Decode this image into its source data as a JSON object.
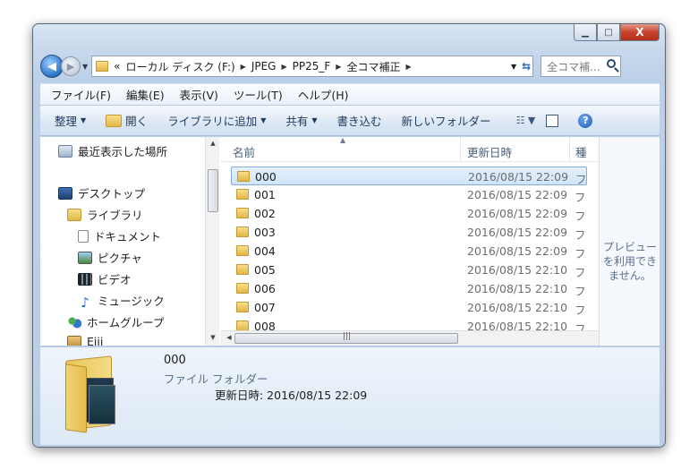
{
  "window": {
    "caption": {
      "minimize": "▁",
      "maximize": "□",
      "close": "X"
    }
  },
  "address": {
    "overflow": "«",
    "crumbs": [
      "ローカル ディスク (F:)",
      "JPEG",
      "PP25_F",
      "全コマ補正"
    ],
    "search_placeholder": "全コマ補..."
  },
  "menu": [
    "ファイル(F)",
    "編集(E)",
    "表示(V)",
    "ツール(T)",
    "ヘルプ(H)"
  ],
  "toolbar": {
    "organize": "整理",
    "open": "開く",
    "add_to_library": "ライブラリに追加",
    "share": "共有",
    "burn": "書き込む",
    "new_folder": "新しいフォルダー"
  },
  "nav": {
    "recent": "最近表示した場所",
    "desktop": "デスクトップ",
    "libraries": "ライブラリ",
    "documents": "ドキュメント",
    "pictures": "ピクチャ",
    "videos": "ビデオ",
    "music": "ミュージック",
    "homegroup": "ホームグループ",
    "user": "Eiji"
  },
  "columns": {
    "name": "名前",
    "date": "更新日時",
    "type": "種"
  },
  "files": [
    {
      "name": "000",
      "date": "2016/08/15 22:09",
      "type": "フ"
    },
    {
      "name": "001",
      "date": "2016/08/15 22:09",
      "type": "フ"
    },
    {
      "name": "002",
      "date": "2016/08/15 22:09",
      "type": "フ"
    },
    {
      "name": "003",
      "date": "2016/08/15 22:09",
      "type": "フ"
    },
    {
      "name": "004",
      "date": "2016/08/15 22:09",
      "type": "フ"
    },
    {
      "name": "005",
      "date": "2016/08/15 22:10",
      "type": "フ"
    },
    {
      "name": "006",
      "date": "2016/08/15 22:10",
      "type": "フ"
    },
    {
      "name": "007",
      "date": "2016/08/15 22:10",
      "type": "フ"
    },
    {
      "name": "008",
      "date": "2016/08/15 22:10",
      "type": "フ"
    }
  ],
  "preview": {
    "message": "プレビューを利用できません。"
  },
  "details": {
    "name": "000",
    "type": "ファイル フォルダー",
    "modified": "更新日時: 2016/08/15 22:09"
  }
}
